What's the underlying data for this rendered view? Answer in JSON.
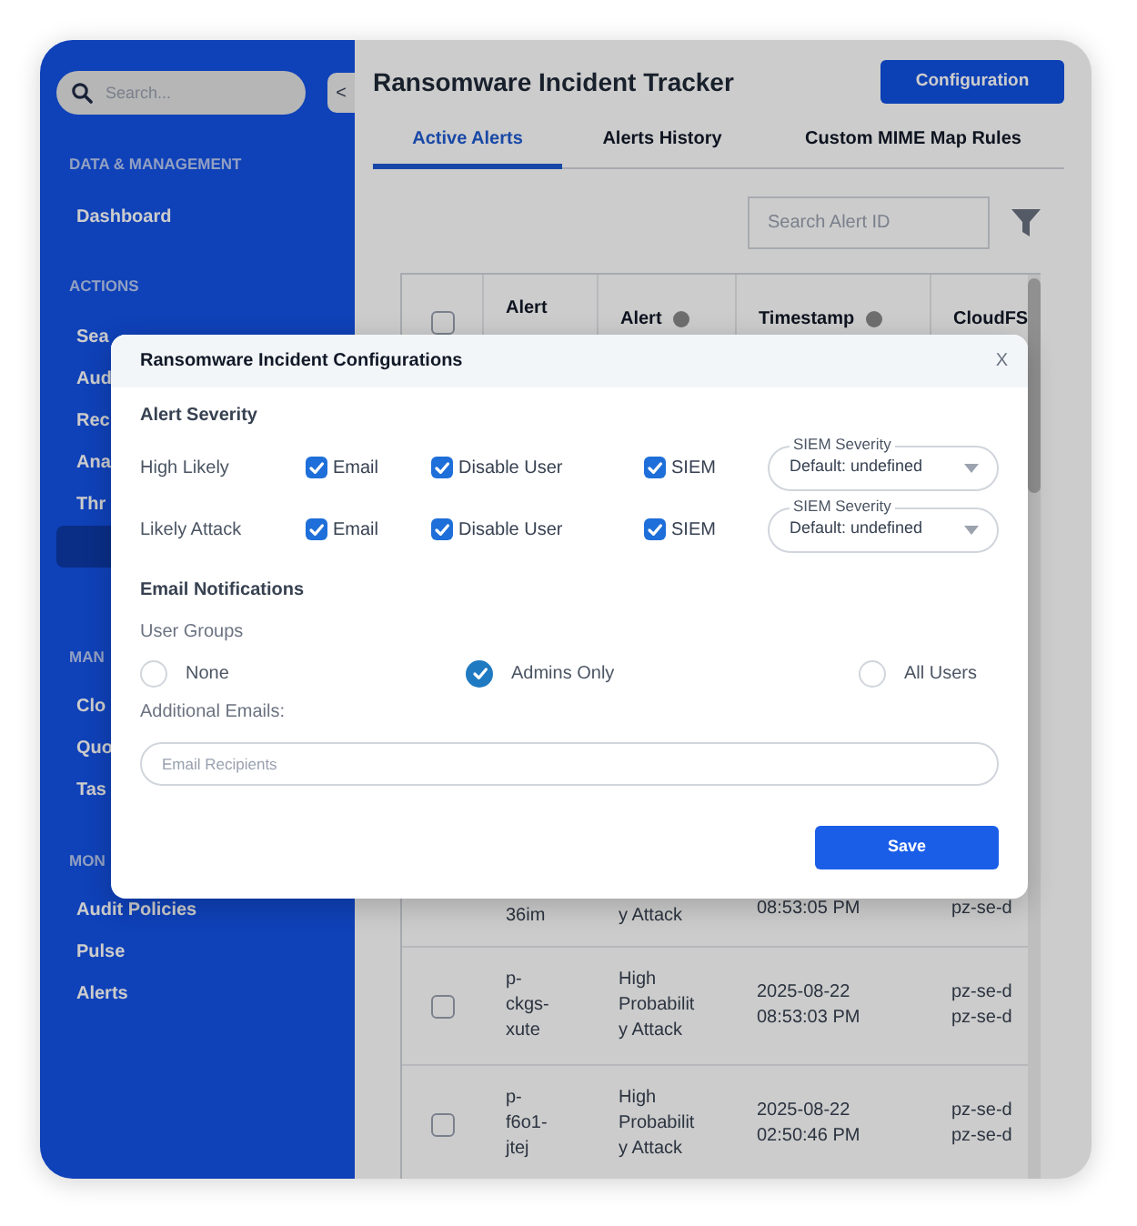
{
  "sidebar": {
    "search": {
      "placeholder": "Search..."
    },
    "collapse_button": "<",
    "sections": [
      {
        "heading": "DATA & MANAGEMENT",
        "items": [
          {
            "label": "Dashboard",
            "selected": false
          }
        ]
      },
      {
        "heading": "ACTIONS",
        "items": [
          {
            "label": "Sea",
            "selected": false
          },
          {
            "label": "Aud",
            "selected": false
          },
          {
            "label": "Rec",
            "selected": false
          },
          {
            "label": "Ana",
            "selected": false
          },
          {
            "label": "Thr",
            "selected": false
          },
          {
            "selected": true
          }
        ]
      },
      {
        "heading": "MAN",
        "items": [
          {
            "label": "Clo",
            "selected": false
          },
          {
            "label": "Quo",
            "selected": false
          },
          {
            "label": "Tas",
            "selected": false
          }
        ]
      },
      {
        "heading": "MON",
        "items": [
          {
            "label": "Audit Policies",
            "selected": false
          },
          {
            "label": "Pulse",
            "selected": false
          },
          {
            "label": "Alerts",
            "selected": false
          }
        ]
      }
    ]
  },
  "main": {
    "title": "Ransomware Incident Tracker",
    "action_button": "Configuration",
    "tabs": [
      {
        "label": "Active Alerts",
        "selected": true
      },
      {
        "label": "Alerts History",
        "selected": false
      },
      {
        "label": "Custom MIME Map Rules",
        "selected": false
      }
    ],
    "search": {
      "placeholder": "Search Alert ID"
    },
    "table": {
      "header_checked": false,
      "columns": [
        {
          "label": "Alert",
          "help": false
        },
        {
          "label": "Alert",
          "help": true
        },
        {
          "label": "Timestamp",
          "help": true
        },
        {
          "label": "CloudFS",
          "help": false
        }
      ],
      "rows": [
        {
          "alert_id": "36im",
          "alert_type": "y Attack",
          "timestamp": "08:53:05 PM",
          "cloudfs": [
            "pz-se-d"
          ]
        },
        {
          "checked": false,
          "alert_id": "p-ckgs-xute",
          "alert_type": "High Probability Attack",
          "timestamp": "2025-08-22 08:53:03 PM",
          "cloudfs": [
            "pz-se-d",
            "pz-se-d"
          ]
        },
        {
          "checked": false,
          "alert_id": "p-f6o1-jtej",
          "alert_type": "High Probability Attack",
          "timestamp": "2025-08-22 02:50:46 PM",
          "cloudfs": [
            "pz-se-d",
            "pz-se-d"
          ]
        }
      ]
    }
  },
  "modal": {
    "title": "Ransomware Incident Configurations",
    "close": "X",
    "severity": {
      "heading": "Alert Severity",
      "rows": [
        {
          "label": "High Likely",
          "options": [
            {
              "label": "Email",
              "checked": true
            },
            {
              "label": "Disable User",
              "checked": true
            },
            {
              "label": "SIEM",
              "checked": true
            }
          ],
          "select": {
            "label": "SIEM Severity",
            "value": "Default: undefined"
          }
        },
        {
          "label": "Likely Attack",
          "options": [
            {
              "label": "Email",
              "checked": true
            },
            {
              "label": "Disable User",
              "checked": true
            },
            {
              "label": "SIEM",
              "checked": true
            }
          ],
          "select": {
            "label": "SIEM Severity",
            "value": "Default: undefined"
          }
        }
      ]
    },
    "notifications": {
      "heading": "Email Notifications",
      "groups_label": "User Groups",
      "groups": [
        {
          "label": "None",
          "selected": false
        },
        {
          "label": "Admins Only",
          "selected": true
        },
        {
          "label": "All Users",
          "selected": false
        }
      ],
      "emails_label": "Additional Emails:",
      "emails_field": {
        "placeholder": "Email Recipients"
      }
    },
    "save_button": "Save"
  }
}
